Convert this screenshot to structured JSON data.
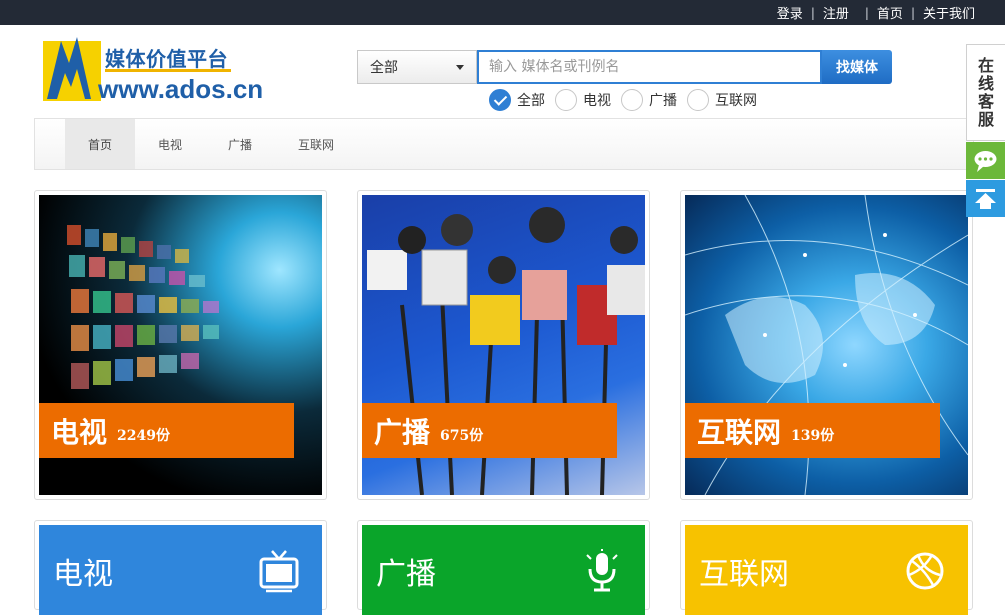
{
  "topbar": {
    "links": [
      "登录",
      "注册",
      "首页",
      "关于我们"
    ]
  },
  "logo": {
    "title": "媒体价值平台",
    "domain": "www.ados.cn"
  },
  "search": {
    "category_selected": "全部",
    "placeholder": "输入 媒体名或刊例名",
    "button_label": "找媒体",
    "radios": [
      {
        "label": "全部",
        "checked": true
      },
      {
        "label": "电视",
        "checked": false
      },
      {
        "label": "广播",
        "checked": false
      },
      {
        "label": "互联网",
        "checked": false
      }
    ]
  },
  "nav": {
    "items": [
      "首页",
      "电视",
      "广播",
      "互联网"
    ],
    "active": "首页"
  },
  "cards": [
    {
      "name": "电视",
      "count": "2249份"
    },
    {
      "name": "广播",
      "count": "675份"
    },
    {
      "name": "互联网",
      "count": "139份"
    }
  ],
  "tiles": [
    {
      "name": "电视",
      "color": "#2f86dc",
      "icon": "tv-icon"
    },
    {
      "name": "广播",
      "color": "#0aa52a",
      "icon": "microphone-icon"
    },
    {
      "name": "互联网",
      "color": "#f7c200",
      "icon": "globe-icon"
    }
  ],
  "side": {
    "customer_service": "在线客服"
  },
  "colors": {
    "topbar": "#232a36",
    "accent_blue": "#2f7fd4",
    "label_orange": "#ec6c00"
  }
}
